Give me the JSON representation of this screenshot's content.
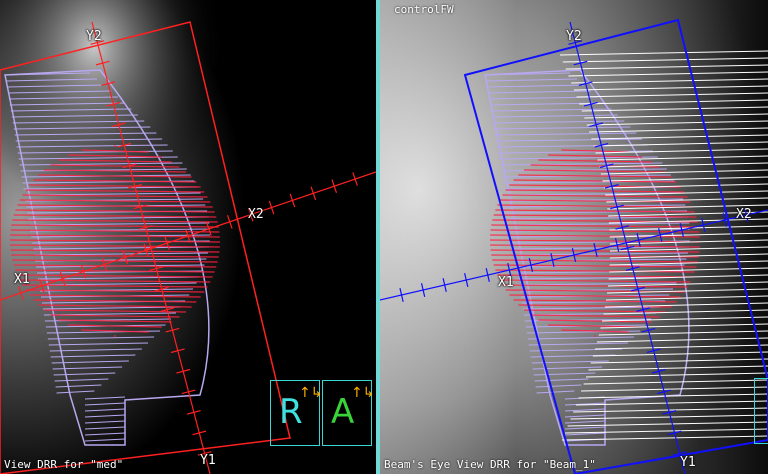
{
  "left_view": {
    "caption": "View DRR for \"med\"",
    "labels": {
      "y2": "Y2",
      "y1": "Y1",
      "x1": "X1",
      "x2": "X2"
    },
    "orientation": [
      {
        "letter": "R",
        "color": "#3fe0e0",
        "arrow": "↑↳"
      },
      {
        "letter": "A",
        "color": "#39d339",
        "arrow": "↑↳"
      }
    ],
    "colors": {
      "field": "#ff2020",
      "contour": "#b8a8f0",
      "target": "#ff2040"
    }
  },
  "right_view": {
    "title": "controlFW",
    "caption": "Beam's Eye View DRR for \"Beam_1\"",
    "labels": {
      "y2": "Y2",
      "y1": "Y1",
      "x1": "X1",
      "x2": "X2"
    },
    "colors": {
      "field": "#1010ff",
      "contour": "#b8a8f0",
      "target": "#ff2040",
      "mlc": "#ffffff"
    }
  },
  "divider_color": "#6fd8d8"
}
